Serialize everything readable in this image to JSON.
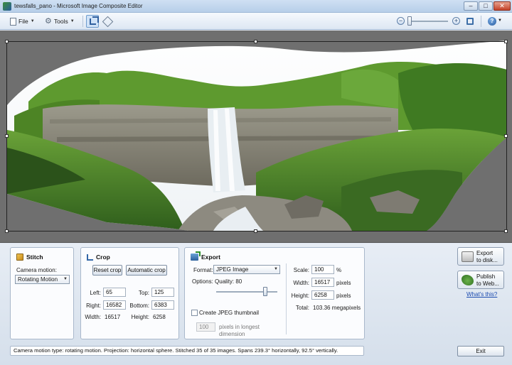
{
  "window": {
    "title": "tewsfalls_pano - Microsoft Image Composite Editor",
    "minimize_glyph": "–",
    "maximize_glyph": "□",
    "close_glyph": "✕"
  },
  "toolbar": {
    "file_label": "File",
    "tools_label": "Tools",
    "zoom_out_glyph": "−",
    "zoom_in_glyph": "+",
    "help_glyph": "?",
    "zoom_level": 0
  },
  "stitch": {
    "title": "Stitch",
    "camera_motion_label": "Camera motion:",
    "camera_motion_value": "Rotating Motion"
  },
  "crop": {
    "title": "Crop",
    "reset_label": "Reset crop",
    "auto_label": "Automatic crop",
    "left_label": "Left:",
    "left_value": "65",
    "top_label": "Top:",
    "top_value": "125",
    "right_label": "Right:",
    "right_value": "16582",
    "bottom_label": "Bottom:",
    "bottom_value": "6383",
    "width_label": "Width:",
    "width_value": "16517",
    "height_label": "Height:",
    "height_value": "6258"
  },
  "export": {
    "title": "Export",
    "format_label": "Format:",
    "format_value": "JPEG Image",
    "options_label": "Options: Quality: 80",
    "quality": 80,
    "thumb_label": "Create JPEG thumbnail",
    "thumb_value": "100",
    "thumb_desc": "pixels in longest dimension",
    "scale_label": "Scale:",
    "scale_value": "100",
    "scale_unit": "%",
    "width_label": "Width:",
    "width_value": "16517",
    "width_unit": "pixels",
    "height_label": "Height:",
    "height_value": "6258",
    "height_unit": "pixels",
    "total_label": "Total:",
    "total_value": "103.36 megapixels"
  },
  "actions": {
    "export_disk": "Export\nto disk...",
    "export_disk_l1": "Export",
    "export_disk_l2": "to disk...",
    "publish_l1": "Publish",
    "publish_l2": "to Web...",
    "whats_this": "What's this?",
    "exit": "Exit"
  },
  "status": {
    "text": "Camera motion type: rotating motion. Projection: horizontal sphere. Stitched 35 of 35 images. Spans 239.3° horizontally, 92.5° vertically."
  },
  "colors": {
    "canvas_bg": "#6f6f6f",
    "sky": "#f4f7fa",
    "foliage": "#4f8a2c",
    "rock": "#8d8a80",
    "water": "#e9eef2"
  }
}
